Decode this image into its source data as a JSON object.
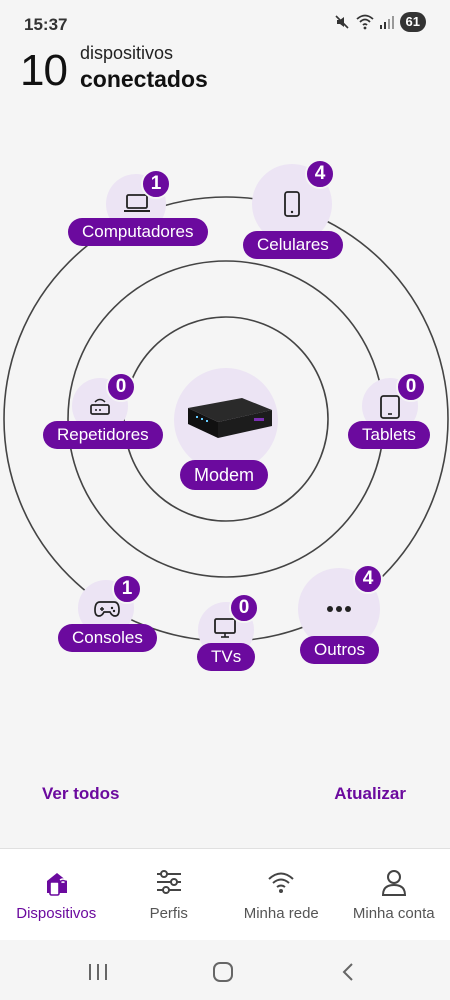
{
  "status": {
    "time": "15:37",
    "battery": "61"
  },
  "header": {
    "count": "10",
    "line1": "dispositivos",
    "line2": "conectados"
  },
  "modem": {
    "label": "Modem"
  },
  "devices": {
    "computadores": {
      "label": "Computadores",
      "count": "1",
      "icon": "laptop-icon"
    },
    "celulares": {
      "label": "Celulares",
      "count": "4",
      "icon": "smartphone-icon"
    },
    "repetidores": {
      "label": "Repetidores",
      "count": "0",
      "icon": "router-icon"
    },
    "tablets": {
      "label": "Tablets",
      "count": "0",
      "icon": "tablet-icon"
    },
    "consoles": {
      "label": "Consoles",
      "count": "1",
      "icon": "gamepad-icon"
    },
    "tvs": {
      "label": "TVs",
      "count": "0",
      "icon": "tv-icon"
    },
    "outros": {
      "label": "Outros",
      "count": "4",
      "icon": "more-icon"
    }
  },
  "actions": {
    "see_all": "Ver todos",
    "refresh": "Atualizar"
  },
  "nav": {
    "items": [
      {
        "label": "Dispositivos",
        "icon": "devices-icon",
        "active": true
      },
      {
        "label": "Perfis",
        "icon": "sliders-icon",
        "active": false
      },
      {
        "label": "Minha rede",
        "icon": "wifi-icon",
        "active": false
      },
      {
        "label": "Minha conta",
        "icon": "user-icon",
        "active": false
      }
    ]
  },
  "colors": {
    "accent": "#6b0a9e",
    "halo": "#ece4f4",
    "background": "#f5f5f5"
  }
}
